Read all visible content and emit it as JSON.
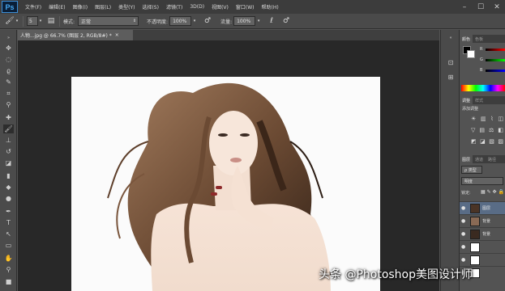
{
  "app": {
    "logo": "Ps",
    "menus": [
      "文件(F)",
      "编辑(E)",
      "图像(I)",
      "图层(L)",
      "类型(Y)",
      "选择(S)",
      "滤镜(T)",
      "3D(D)",
      "视图(V)",
      "窗口(W)",
      "帮助(H)"
    ],
    "window_controls": {
      "minimize": "–",
      "maximize": "☐",
      "close": "✕"
    }
  },
  "options": {
    "brush_size": "5",
    "mode_label": "模式:",
    "mode_value": "正常",
    "opacity_label": "不透明度:",
    "opacity_value": "100%",
    "flow_label": "流量:",
    "flow_value": "100%"
  },
  "document": {
    "tab_title": "人物...jpg @ 66.7% (图层 2, RGB/8#) *",
    "close": "×"
  },
  "panels": {
    "color_tabs": [
      "颜色",
      "色板"
    ],
    "color_channels": [
      "R",
      "G",
      "B"
    ],
    "adjust_tabs": [
      "调整",
      "样式"
    ],
    "adjust_title": "添加调整",
    "layers_tabs": [
      "图层",
      "通道",
      "路径"
    ],
    "kind_label": "ρ 类型",
    "blend_mode": "明度",
    "lock_label": "锁定:",
    "layers": [
      {
        "name": "图层",
        "selected": true
      },
      {
        "name": "背景",
        "selected": false
      },
      {
        "name": "背景",
        "selected": false
      },
      {
        "name": "",
        "selected": false
      },
      {
        "name": "",
        "selected": false
      },
      {
        "name": "",
        "selected": false
      }
    ]
  },
  "watermark": "头条 @Photoshop美图设计师",
  "colors": {
    "menubar": "#3c3c3c",
    "panel": "#535353",
    "canvas_bg": "#282828",
    "selection": "#596c86",
    "ps_blue": "#47a8f0"
  }
}
